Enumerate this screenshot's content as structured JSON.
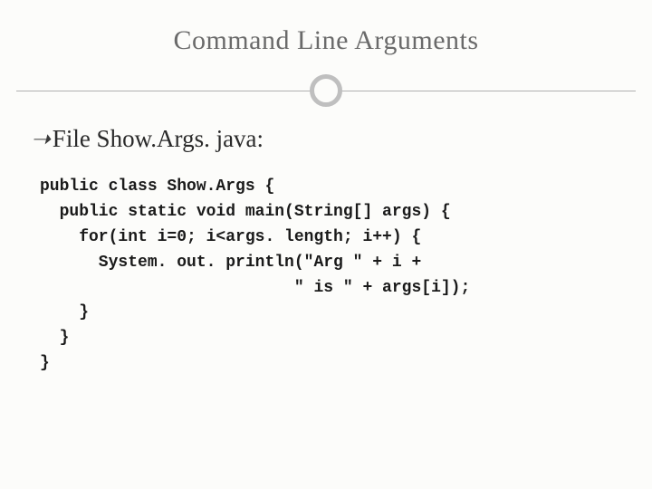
{
  "title": "Command Line Arguments",
  "bullet": {
    "glyph": "ྀ",
    "text": "File Show.Args. java:"
  },
  "code": "public class Show.Args {\n  public static void main(String[] args) {\n    for(int i=0; i<args. length; i++) {\n      System. out. println(\"Arg \" + i +\n                          \" is \" + args[i]);\n    }\n  }\n}"
}
